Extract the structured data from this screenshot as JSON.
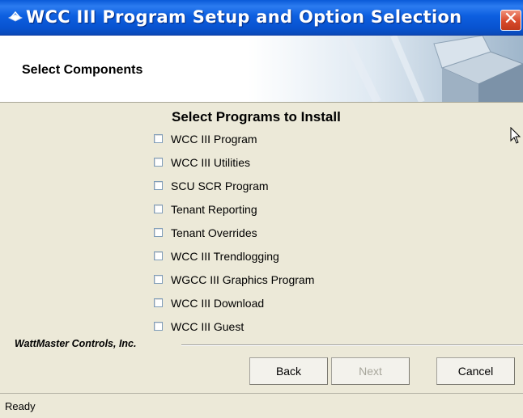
{
  "window": {
    "title": "WCC III Program Setup and Option Selection",
    "close_label": "✕",
    "app_icon": "installer-icon"
  },
  "header": {
    "title": "Select Components",
    "art": "open-box-graphic"
  },
  "main": {
    "section_title": "Select Programs to Install",
    "programs": [
      {
        "label": "WCC III Program",
        "checked": false
      },
      {
        "label": "WCC III Utilities",
        "checked": false
      },
      {
        "label": "SCU SCR Program",
        "checked": false
      },
      {
        "label": "Tenant Reporting",
        "checked": false
      },
      {
        "label": "Tenant Overrides",
        "checked": false
      },
      {
        "label": "WCC III Trendlogging",
        "checked": false
      },
      {
        "label": "WGCC III Graphics Program",
        "checked": false
      },
      {
        "label": "WCC III Download",
        "checked": false
      },
      {
        "label": "WCC III Guest",
        "checked": false
      }
    ]
  },
  "footer": {
    "brand": "WattMaster Controls, Inc.",
    "buttons": {
      "back": "Back",
      "next": "Next",
      "cancel": "Cancel"
    },
    "next_enabled": false
  },
  "status": {
    "text": "Ready"
  }
}
